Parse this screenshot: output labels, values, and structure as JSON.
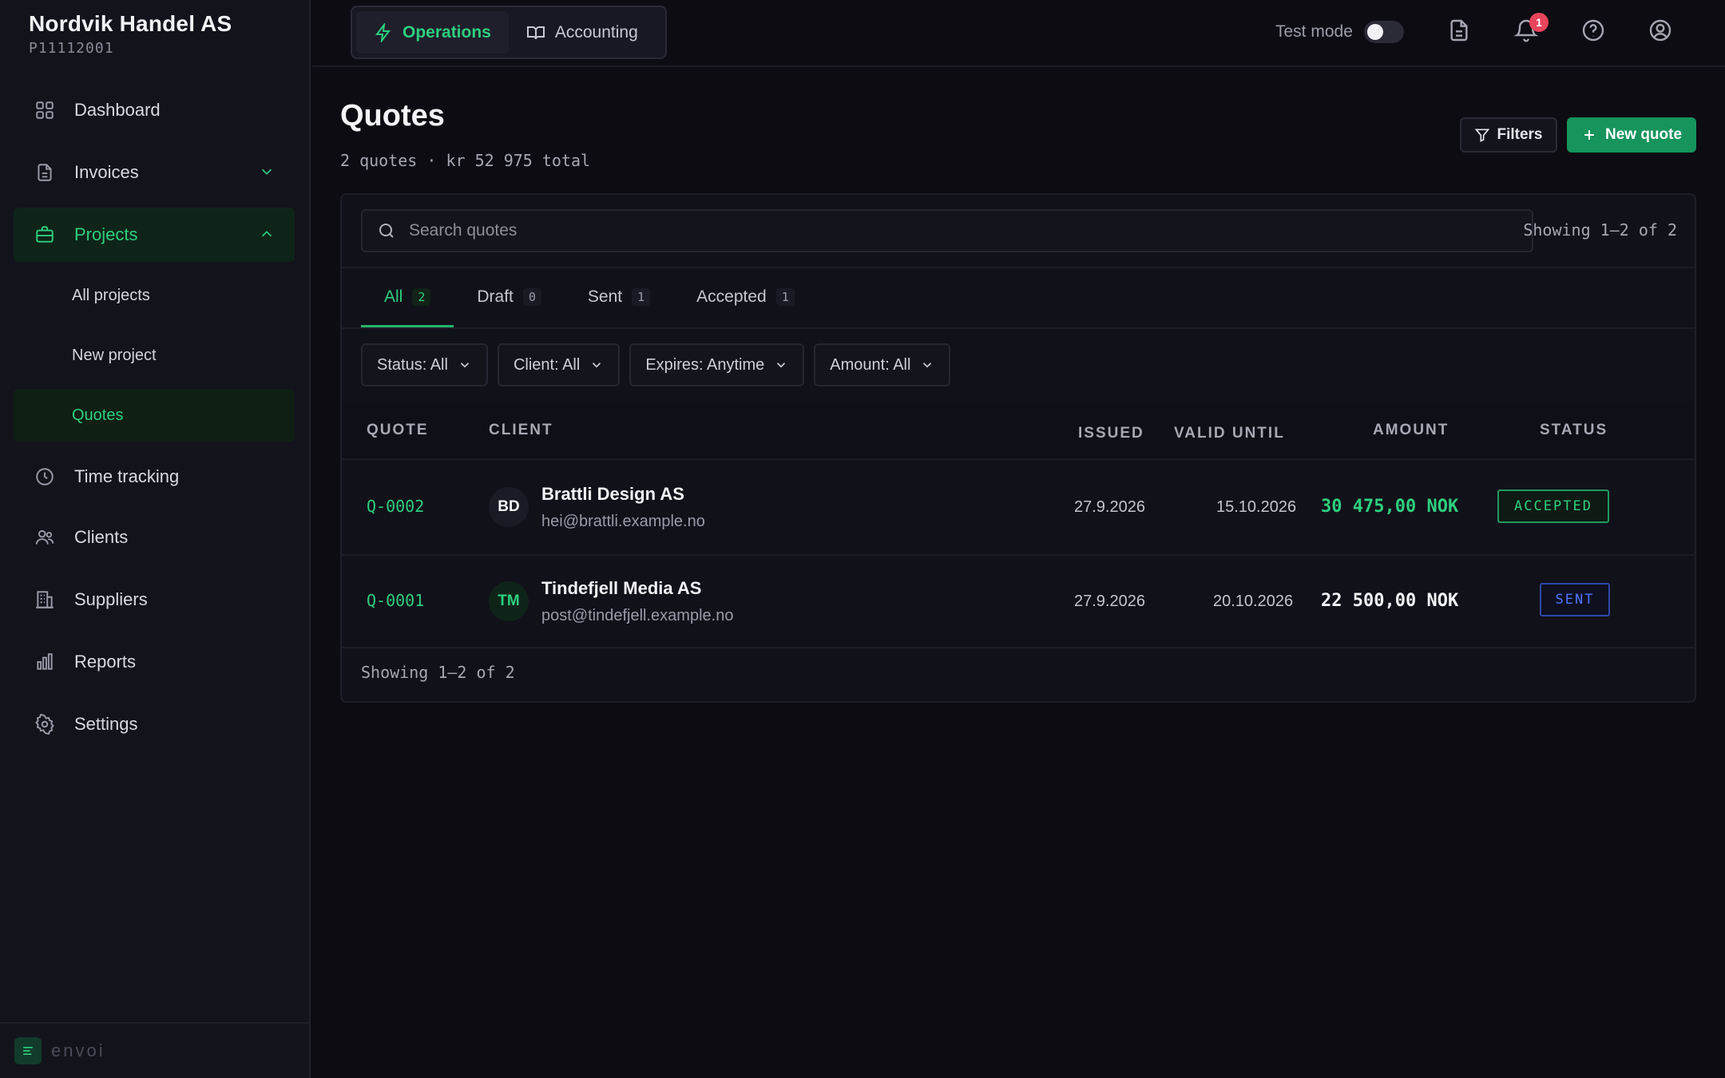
{
  "org": {
    "name": "Nordvik Handel AS",
    "id": "P11112001"
  },
  "nav": {
    "dashboard": "Dashboard",
    "invoices": "Invoices",
    "projects": "Projects",
    "projects_sub": {
      "all": "All projects",
      "new": "New project",
      "quotes": "Quotes"
    },
    "time_tracking": "Time tracking",
    "clients": "Clients",
    "suppliers": "Suppliers",
    "reports": "Reports",
    "settings": "Settings"
  },
  "footer": {
    "brand": "envoi"
  },
  "topbar": {
    "segments": {
      "operations": "Operations",
      "accounting": "Accounting"
    },
    "test_mode_label": "Test mode",
    "test_mode_on": false,
    "notification_count": "1"
  },
  "page": {
    "title": "Quotes",
    "subtitle": "2 quotes · kr 52 975 total",
    "filters_button": "Filters",
    "new_button": "New quote"
  },
  "search": {
    "placeholder": "Search quotes",
    "showing": "Showing 1–2 of 2"
  },
  "tabs": [
    {
      "label": "All",
      "count": "2"
    },
    {
      "label": "Draft",
      "count": "0"
    },
    {
      "label": "Sent",
      "count": "1"
    },
    {
      "label": "Accepted",
      "count": "1"
    }
  ],
  "filter_chips": [
    "Status: All",
    "Client: All",
    "Expires: Anytime",
    "Amount: All"
  ],
  "table": {
    "headers": {
      "quote": "QUOTE",
      "client": "CLIENT",
      "issued": "ISSUED",
      "valid_until": "VALID UNTIL",
      "amount": "AMOUNT",
      "status": "STATUS"
    },
    "rows": [
      {
        "id": "Q-0002",
        "initials": "BD",
        "client": "Brattli Design AS",
        "email": "hei@brattli.example.no",
        "issued": "27.9.2026",
        "valid_until": "15.10.2026",
        "amount": "30 475,00 NOK",
        "status": "ACCEPTED"
      },
      {
        "id": "Q-0001",
        "initials": "TM",
        "client": "Tindefjell Media AS",
        "email": "post@tindefjell.example.no",
        "issued": "27.9.2026",
        "valid_until": "20.10.2026",
        "amount": "22 500,00 NOK",
        "status": "SENT"
      }
    ]
  },
  "pagination": {
    "showing": "Showing 1–2 of 2"
  },
  "colors": {
    "accent": "#2ecf7e",
    "primary_button": "#16945c",
    "sent_blue": "#4f73ff",
    "badge_red": "#e8445c"
  }
}
